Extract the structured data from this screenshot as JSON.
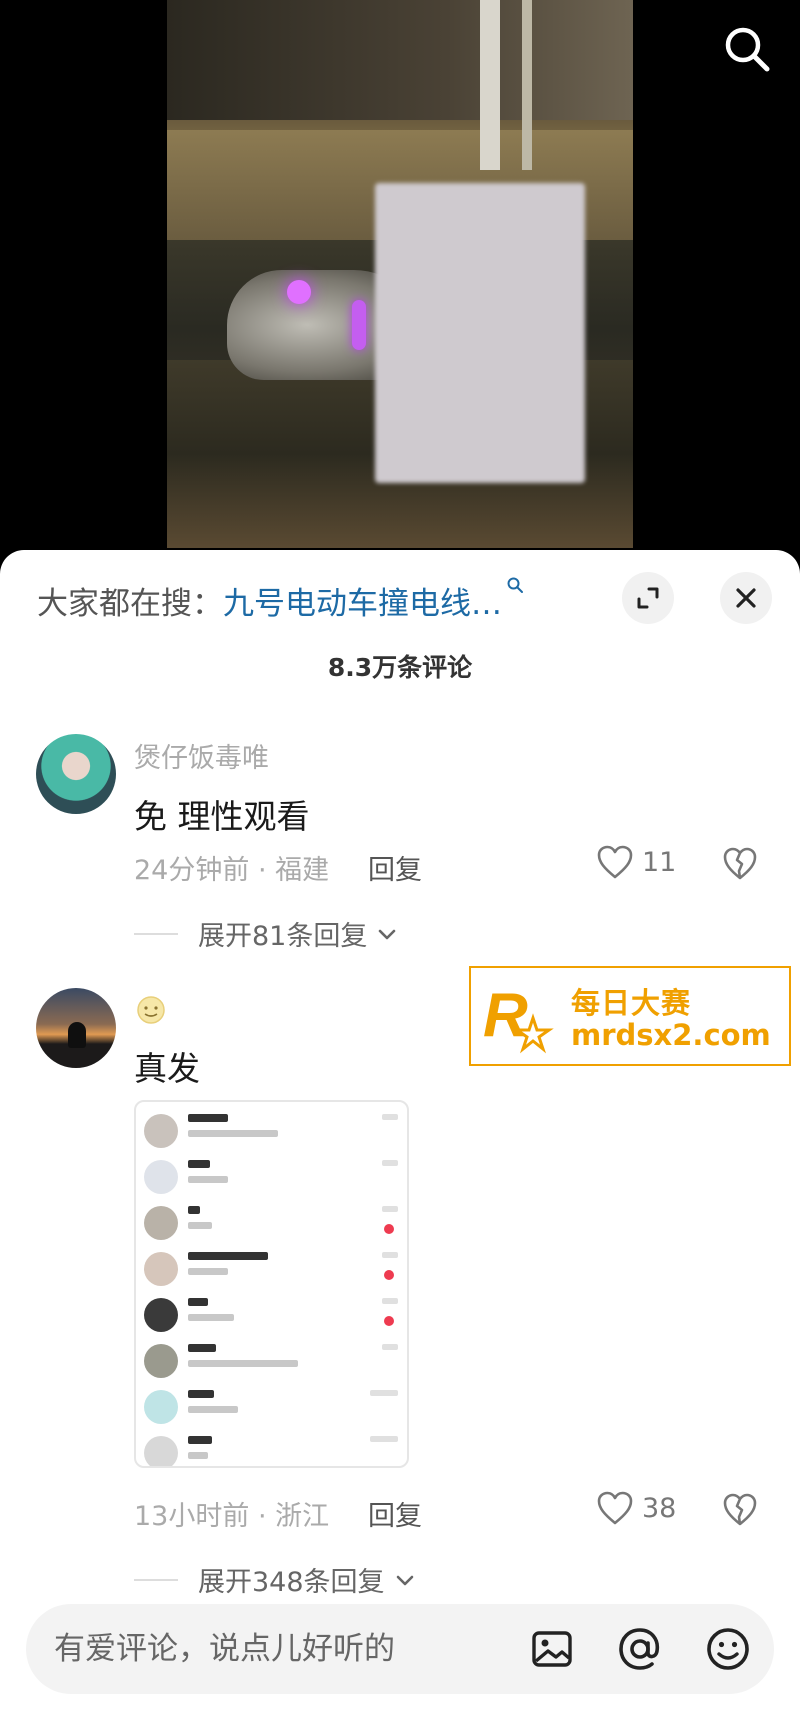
{
  "hot_search": {
    "prefix": "大家都在搜：",
    "query": "九号电动车撞电线…"
  },
  "comment_count": "8.3万条评论",
  "comments": [
    {
      "username": "煲仔饭毒唯",
      "text": "免 理性观看",
      "time_location": "24分钟前 · 福建",
      "reply_label": "回复",
      "likes": "11",
      "expand_label": "展开81条回复"
    },
    {
      "username": "",
      "text": "真发",
      "time_location": "13小时前 · 浙江",
      "reply_label": "回复",
      "likes": "38",
      "expand_label": "展开348条回复"
    }
  ],
  "watermark": {
    "text": "每日大赛",
    "url": "mrdsx2.com"
  },
  "input": {
    "placeholder": "有爱评论，说点儿好听的"
  },
  "icons": {
    "top_right": "search-icon",
    "sheet_expand": "expand-icon",
    "sheet_close": "close-icon",
    "like": "heart-outline-icon",
    "dislike": "broken-heart-icon",
    "input_image": "image-icon",
    "input_mention": "at-icon",
    "input_emoji": "emoji-icon"
  },
  "colors": {
    "search_link": "#1d6aa5",
    "watermark": "#f0a000",
    "sheet_bg": "#ffffff"
  }
}
